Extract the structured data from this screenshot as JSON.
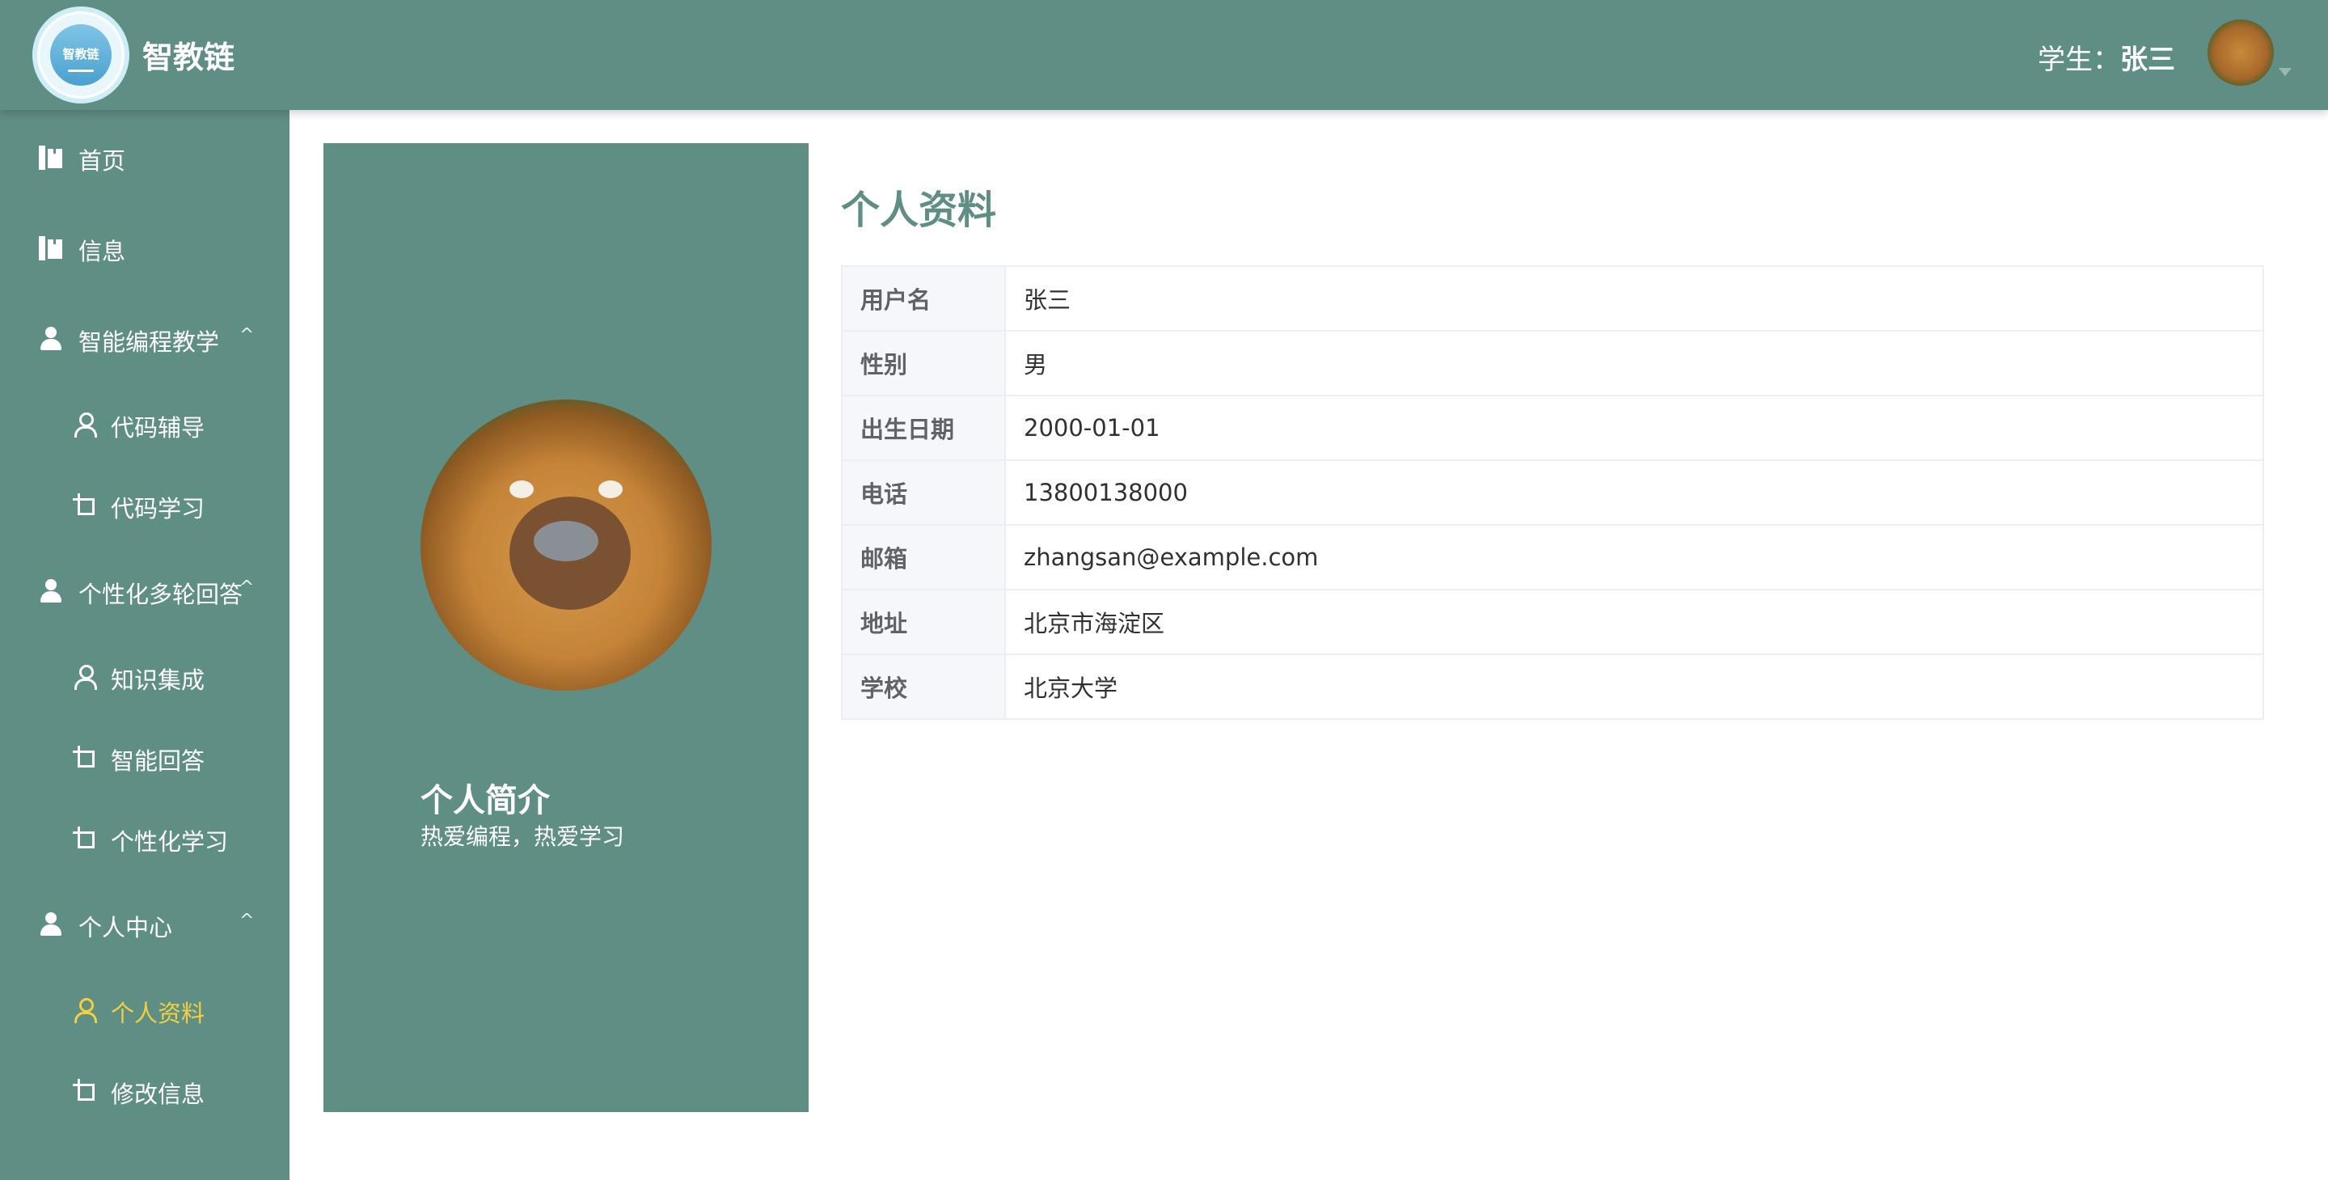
{
  "header": {
    "logo_text": "智教链",
    "brand": "智教链",
    "user_prefix": "学生：",
    "user_name": "张三"
  },
  "sidebar": {
    "items": [
      {
        "label": "首页",
        "icon": "book-icon"
      },
      {
        "label": "信息",
        "icon": "book-icon"
      },
      {
        "label": "智能编程教学",
        "icon": "user-icon",
        "expanded": true
      },
      {
        "label": "代码辅导",
        "icon": "user-outline-icon"
      },
      {
        "label": "代码学习",
        "icon": "crop-icon"
      },
      {
        "label": "个性化多轮回答",
        "icon": "user-icon",
        "expanded": true
      },
      {
        "label": "知识集成",
        "icon": "user-outline-icon"
      },
      {
        "label": "智能回答",
        "icon": "crop-icon"
      },
      {
        "label": "个性化学习",
        "icon": "crop-icon"
      },
      {
        "label": "个人中心",
        "icon": "user-icon",
        "expanded": true
      },
      {
        "label": "个人资料",
        "icon": "user-outline-icon",
        "active": true
      },
      {
        "label": "修改信息",
        "icon": "crop-icon"
      }
    ],
    "arrow": "^"
  },
  "profile_card": {
    "bio_title": "个人简介",
    "bio_text": "热爱编程，热爱学习"
  },
  "info": {
    "title": "个人资料",
    "rows": [
      {
        "key": "用户名",
        "value": "张三"
      },
      {
        "key": "性别",
        "value": "男"
      },
      {
        "key": "出生日期",
        "value": "2000-01-01"
      },
      {
        "key": "电话",
        "value": "13800138000"
      },
      {
        "key": "邮箱",
        "value": "zhangsan@example.com"
      },
      {
        "key": "地址",
        "value": "北京市海淀区"
      },
      {
        "key": "学校",
        "value": "北京大学"
      }
    ]
  },
  "colors": {
    "primary": "#5f8e84",
    "active": "#f4d03f",
    "table_key_bg": "#f5f7fa",
    "table_border": "#ebeef5"
  }
}
